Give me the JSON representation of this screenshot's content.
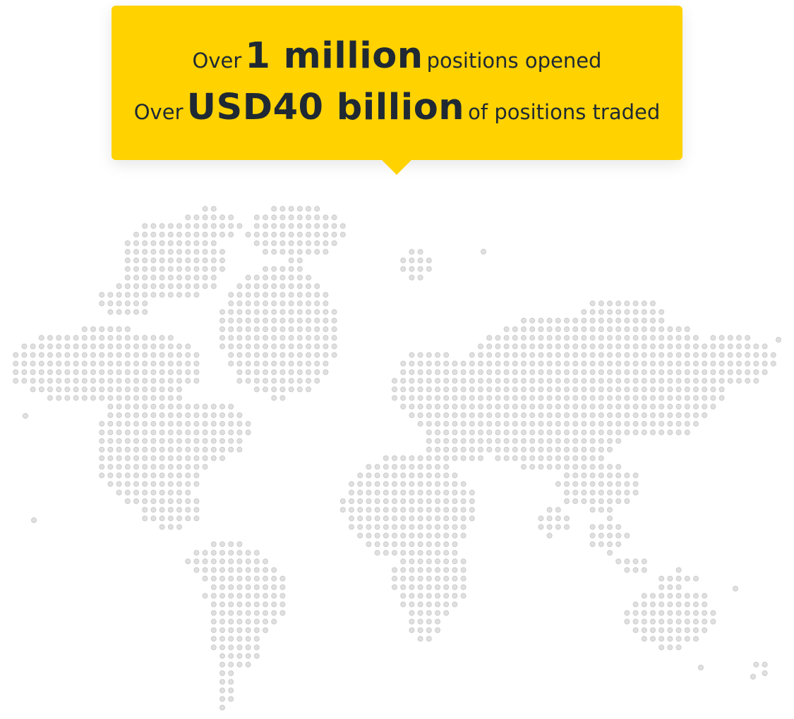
{
  "callout": {
    "line1": {
      "prefix": "Over",
      "highlight": "1 million",
      "suffix": "positions opened"
    },
    "line2": {
      "prefix": "Over",
      "highlight": "USD40 billion",
      "suffix": "of positions traded"
    }
  },
  "colors": {
    "callout_background": "#ffd200",
    "text": "#1f2933",
    "map_dot_fill": "#e0e0e0",
    "map_dot_stroke": "#cccccc"
  }
}
